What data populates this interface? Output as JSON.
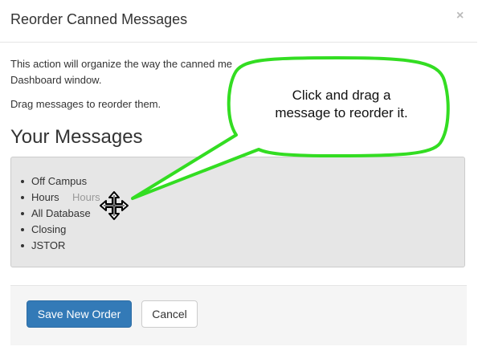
{
  "modal": {
    "title": "Reorder Canned Messages",
    "close_glyph": "×",
    "intro_line1": "This action will organize the way the canned me",
    "intro_line2": "Dashboard window.",
    "instruction": "Drag messages to reorder them.",
    "messages_heading": "Your Messages",
    "messages": [
      "Off Campus",
      "Hours",
      "All Database",
      "Closing",
      "JSTOR"
    ],
    "dragging_ghost": "Hours",
    "save_button": "Save New Order",
    "cancel_button": "Cancel"
  },
  "callout": {
    "line1": "Click and drag a",
    "line2": "message to reorder it."
  },
  "colors": {
    "primary": "#337ab7",
    "callout_border": "#33dd22",
    "well": "#e6e6e6"
  },
  "icons": {
    "drag_cursor": "move-cursor-icon",
    "close": "close-icon"
  }
}
